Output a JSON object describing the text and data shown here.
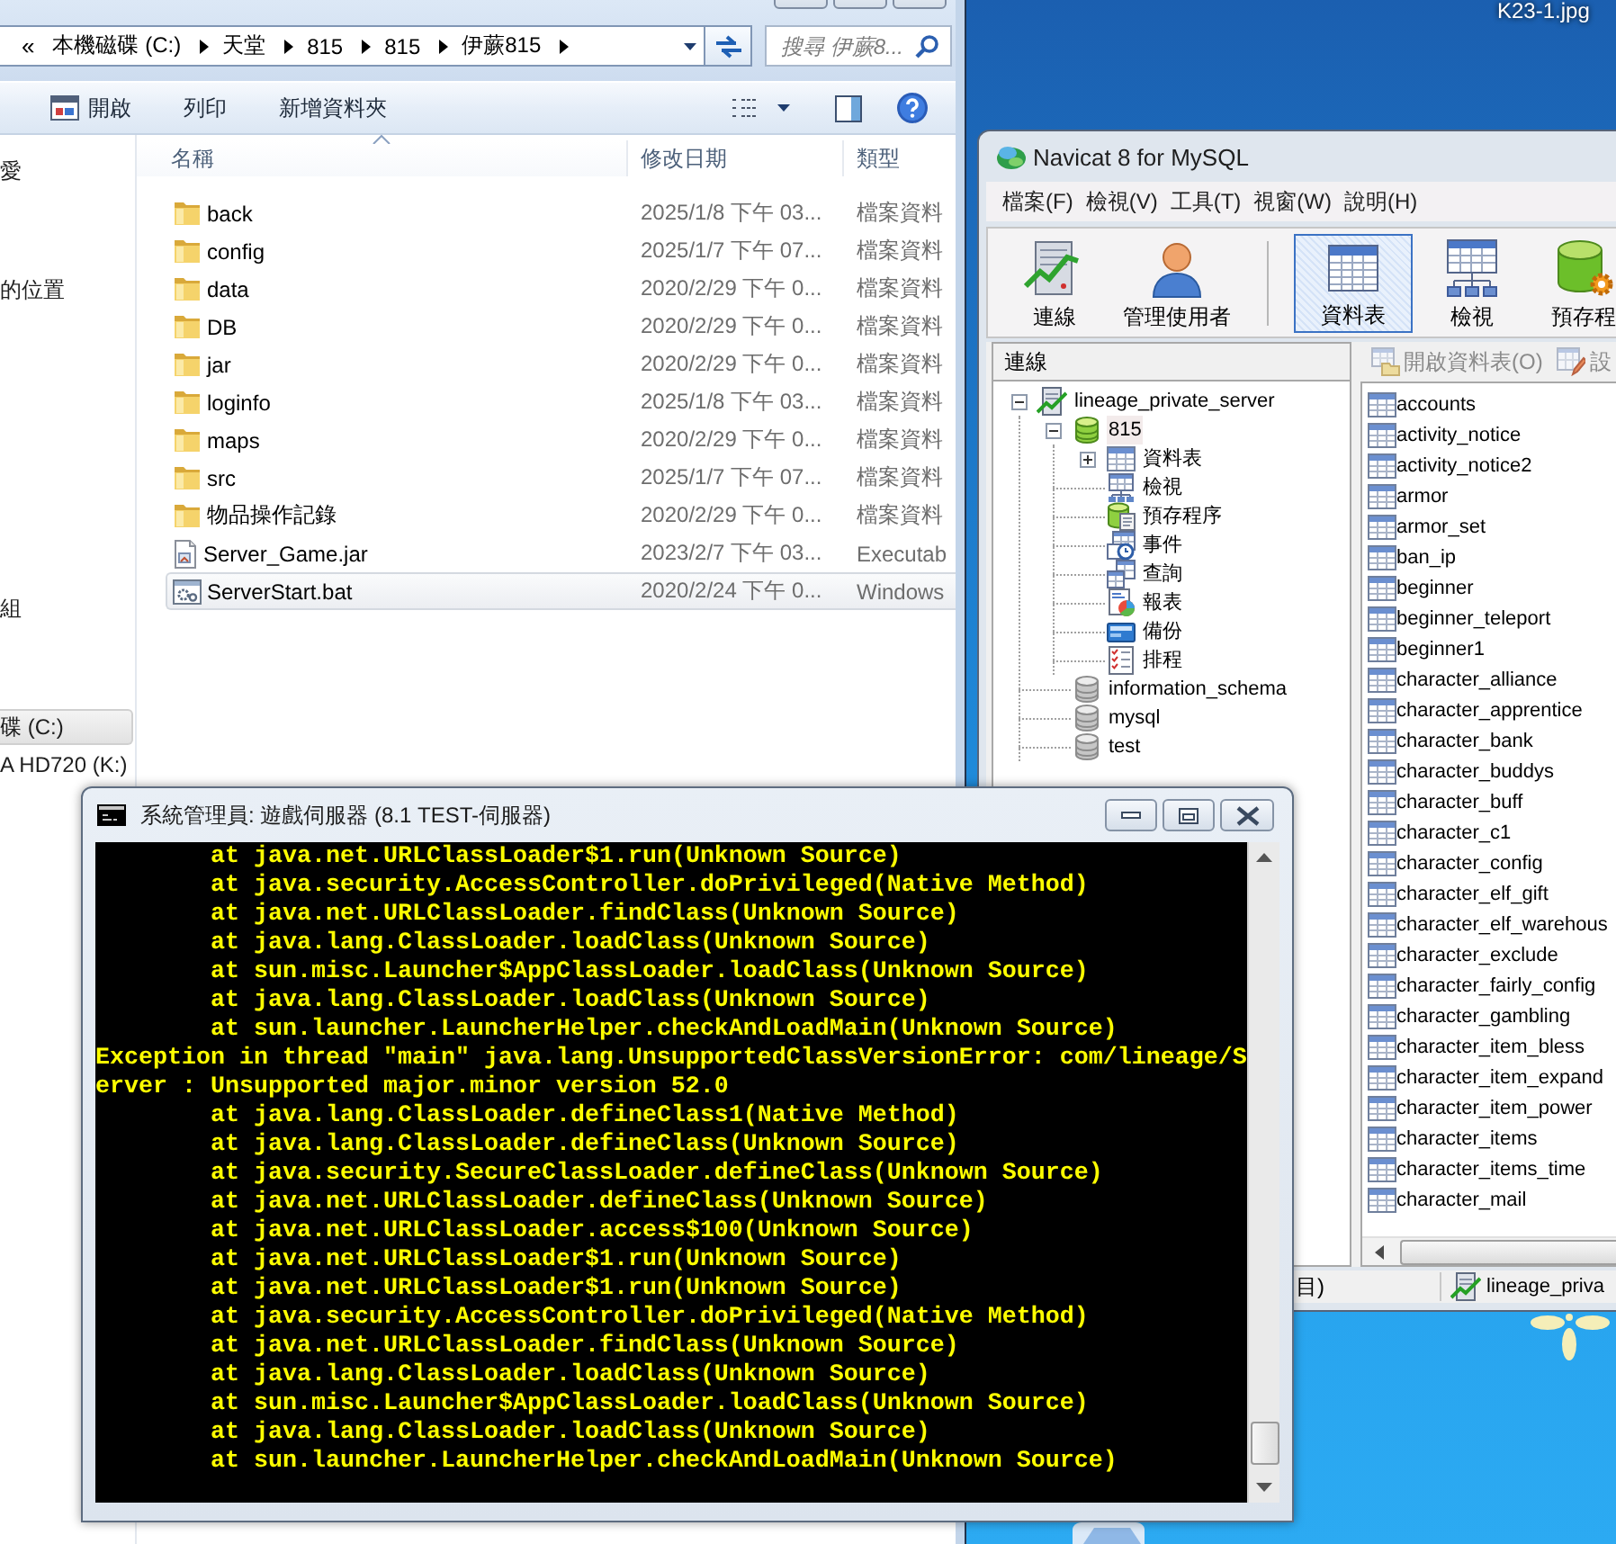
{
  "desktop": {
    "icons": [
      {
        "label": "K23-1.jpg"
      }
    ]
  },
  "explorer": {
    "address": {
      "overflow": "«",
      "crumbs": [
        "本機磁碟 (C:)",
        "天堂",
        "815",
        "815",
        "伊蕨815"
      ]
    },
    "search": {
      "placeholder": "搜尋 伊蕨8..."
    },
    "toolbar": [
      {
        "label": "開啟",
        "kind": "open"
      },
      {
        "label": "列印",
        "kind": "print"
      },
      {
        "label": "新增資料夾",
        "kind": "new_folder"
      }
    ],
    "nav_pane": [
      {
        "label": "愛",
        "selected": false
      },
      {
        "label": "的位置",
        "selected": false
      },
      {
        "label": "組",
        "selected": false
      },
      {
        "label": "碟 (C:)",
        "selected": true
      },
      {
        "label": "A HD720 (K:)",
        "selected": false
      }
    ],
    "columns": [
      {
        "label": "名稱",
        "sorted": true
      },
      {
        "label": "修改日期",
        "sorted": false
      },
      {
        "label": "類型",
        "sorted": false
      }
    ],
    "files": [
      {
        "name": "back",
        "kind": "folder",
        "modified": "2025/1/8 下午 03...",
        "type": "檔案資料",
        "selected": false
      },
      {
        "name": "config",
        "kind": "folder",
        "modified": "2025/1/7 下午 07...",
        "type": "檔案資料",
        "selected": false
      },
      {
        "name": "data",
        "kind": "folder",
        "modified": "2020/2/29 下午 0...",
        "type": "檔案資料",
        "selected": false
      },
      {
        "name": "DB",
        "kind": "folder",
        "modified": "2020/2/29 下午 0...",
        "type": "檔案資料",
        "selected": false
      },
      {
        "name": "jar",
        "kind": "folder",
        "modified": "2020/2/29 下午 0...",
        "type": "檔案資料",
        "selected": false
      },
      {
        "name": "loginfo",
        "kind": "folder",
        "modified": "2025/1/8 下午 03...",
        "type": "檔案資料",
        "selected": false
      },
      {
        "name": "maps",
        "kind": "folder",
        "modified": "2020/2/29 下午 0...",
        "type": "檔案資料",
        "selected": false
      },
      {
        "name": "src",
        "kind": "folder",
        "modified": "2025/1/7 下午 07...",
        "type": "檔案資料",
        "selected": false
      },
      {
        "name": "物品操作記錄",
        "kind": "folder",
        "modified": "2020/2/29 下午 0...",
        "type": "檔案資料",
        "selected": false
      },
      {
        "name": "Server_Game.jar",
        "kind": "jar",
        "modified": "2023/2/7 下午 03...",
        "type": "Executab",
        "selected": false
      },
      {
        "name": "ServerStart.bat",
        "kind": "batch",
        "modified": "2020/2/24 下午 0...",
        "type": "Windows",
        "selected": true
      }
    ]
  },
  "navicat": {
    "title": "Navicat 8 for MySQL",
    "menu": [
      "檔案(F)",
      "檢視(V)",
      "工具(T)",
      "視窗(W)",
      "說明(H)"
    ],
    "toolbar": [
      {
        "label": "連線",
        "kind": "connection",
        "selected": false
      },
      {
        "label": "管理使用者",
        "kind": "user",
        "selected": false
      },
      {
        "label": "資料表",
        "kind": "table",
        "selected": true
      },
      {
        "label": "檢視",
        "kind": "view",
        "selected": false
      },
      {
        "label": "預存程",
        "kind": "procedure",
        "selected": false
      }
    ],
    "tree_header": "連線",
    "tree": [
      {
        "label": "lineage_private_server",
        "kind": "connection",
        "expanded": true,
        "selected": false,
        "children": [
          {
            "label": "815",
            "kind": "database",
            "connected": true,
            "expanded": true,
            "selected": true,
            "children": [
              {
                "label": "資料表",
                "kind": "tables",
                "expanded": false,
                "selected": false
              },
              {
                "label": "檢視",
                "kind": "views",
                "selected": false
              },
              {
                "label": "預存程序",
                "kind": "procedures",
                "selected": false
              },
              {
                "label": "事件",
                "kind": "events",
                "selected": false
              },
              {
                "label": "查詢",
                "kind": "queries",
                "selected": false
              },
              {
                "label": "報表",
                "kind": "reports",
                "selected": false
              },
              {
                "label": "備份",
                "kind": "backups",
                "selected": false
              },
              {
                "label": "排程",
                "kind": "schedules",
                "selected": false
              }
            ]
          },
          {
            "label": "information_schema",
            "kind": "database",
            "connected": false,
            "selected": false
          },
          {
            "label": "mysql",
            "kind": "database",
            "connected": false,
            "selected": false
          },
          {
            "label": "test",
            "kind": "database",
            "connected": false,
            "selected": false
          }
        ]
      }
    ],
    "objects_toolbar": [
      {
        "label": "開啟資料表(O)",
        "kind": "open",
        "disabled": true
      },
      {
        "label": "設",
        "kind": "design",
        "disabled": true
      }
    ],
    "tables": [
      "accounts",
      "activity_notice",
      "activity_notice2",
      "armor",
      "armor_set",
      "ban_ip",
      "beginner",
      "beginner_teleport",
      "beginner1",
      "character_alliance",
      "character_apprentice",
      "character_bank",
      "character_buddys",
      "character_buff",
      "character_c1",
      "character_config",
      "character_elf_gift",
      "character_elf_warehous",
      "character_exclude",
      "character_fairly_config",
      "character_gambling",
      "character_item_bless",
      "character_item_expand",
      "character_item_power",
      "character_items",
      "character_items_time",
      "character_mail"
    ],
    "status_bar": {
      "text": "目)",
      "connection": "lineage_priva"
    }
  },
  "console": {
    "title": "系統管理員: 遊戲伺服器 (8.1 TEST-伺服器)",
    "lines": [
      {
        "kind": "frame",
        "text": "at java.net.URLClassLoader$1.run(Unknown Source)"
      },
      {
        "kind": "frame",
        "text": "at java.security.AccessController.doPrivileged(Native Method)"
      },
      {
        "kind": "frame",
        "text": "at java.net.URLClassLoader.findClass(Unknown Source)"
      },
      {
        "kind": "frame",
        "text": "at java.lang.ClassLoader.loadClass(Unknown Source)"
      },
      {
        "kind": "frame",
        "text": "at sun.misc.Launcher$AppClassLoader.loadClass(Unknown Source)"
      },
      {
        "kind": "frame",
        "text": "at java.lang.ClassLoader.loadClass(Unknown Source)"
      },
      {
        "kind": "frame",
        "text": "at sun.launcher.LauncherHelper.checkAndLoadMain(Unknown Source)"
      },
      {
        "kind": "message",
        "text": "Exception in thread \"main\" java.lang.UnsupportedClassVersionError: com/lineage/S"
      },
      {
        "kind": "message",
        "text": "erver : Unsupported major.minor version 52.0"
      },
      {
        "kind": "frame",
        "text": "at java.lang.ClassLoader.defineClass1(Native Method)"
      },
      {
        "kind": "frame",
        "text": "at java.lang.ClassLoader.defineClass(Unknown Source)"
      },
      {
        "kind": "frame",
        "text": "at java.security.SecureClassLoader.defineClass(Unknown Source)"
      },
      {
        "kind": "frame",
        "text": "at java.net.URLClassLoader.defineClass(Unknown Source)"
      },
      {
        "kind": "frame",
        "text": "at java.net.URLClassLoader.access$100(Unknown Source)"
      },
      {
        "kind": "frame",
        "text": "at java.net.URLClassLoader$1.run(Unknown Source)"
      },
      {
        "kind": "frame",
        "text": "at java.net.URLClassLoader$1.run(Unknown Source)"
      },
      {
        "kind": "frame",
        "text": "at java.security.AccessController.doPrivileged(Native Method)"
      },
      {
        "kind": "frame",
        "text": "at java.net.URLClassLoader.findClass(Unknown Source)"
      },
      {
        "kind": "frame",
        "text": "at java.lang.ClassLoader.loadClass(Unknown Source)"
      },
      {
        "kind": "frame",
        "text": "at sun.misc.Launcher$AppClassLoader.loadClass(Unknown Source)"
      },
      {
        "kind": "frame",
        "text": "at java.lang.ClassLoader.loadClass(Unknown Source)"
      },
      {
        "kind": "frame",
        "text": "at sun.launcher.LauncherHelper.checkAndLoadMain(Unknown Source)"
      }
    ]
  }
}
